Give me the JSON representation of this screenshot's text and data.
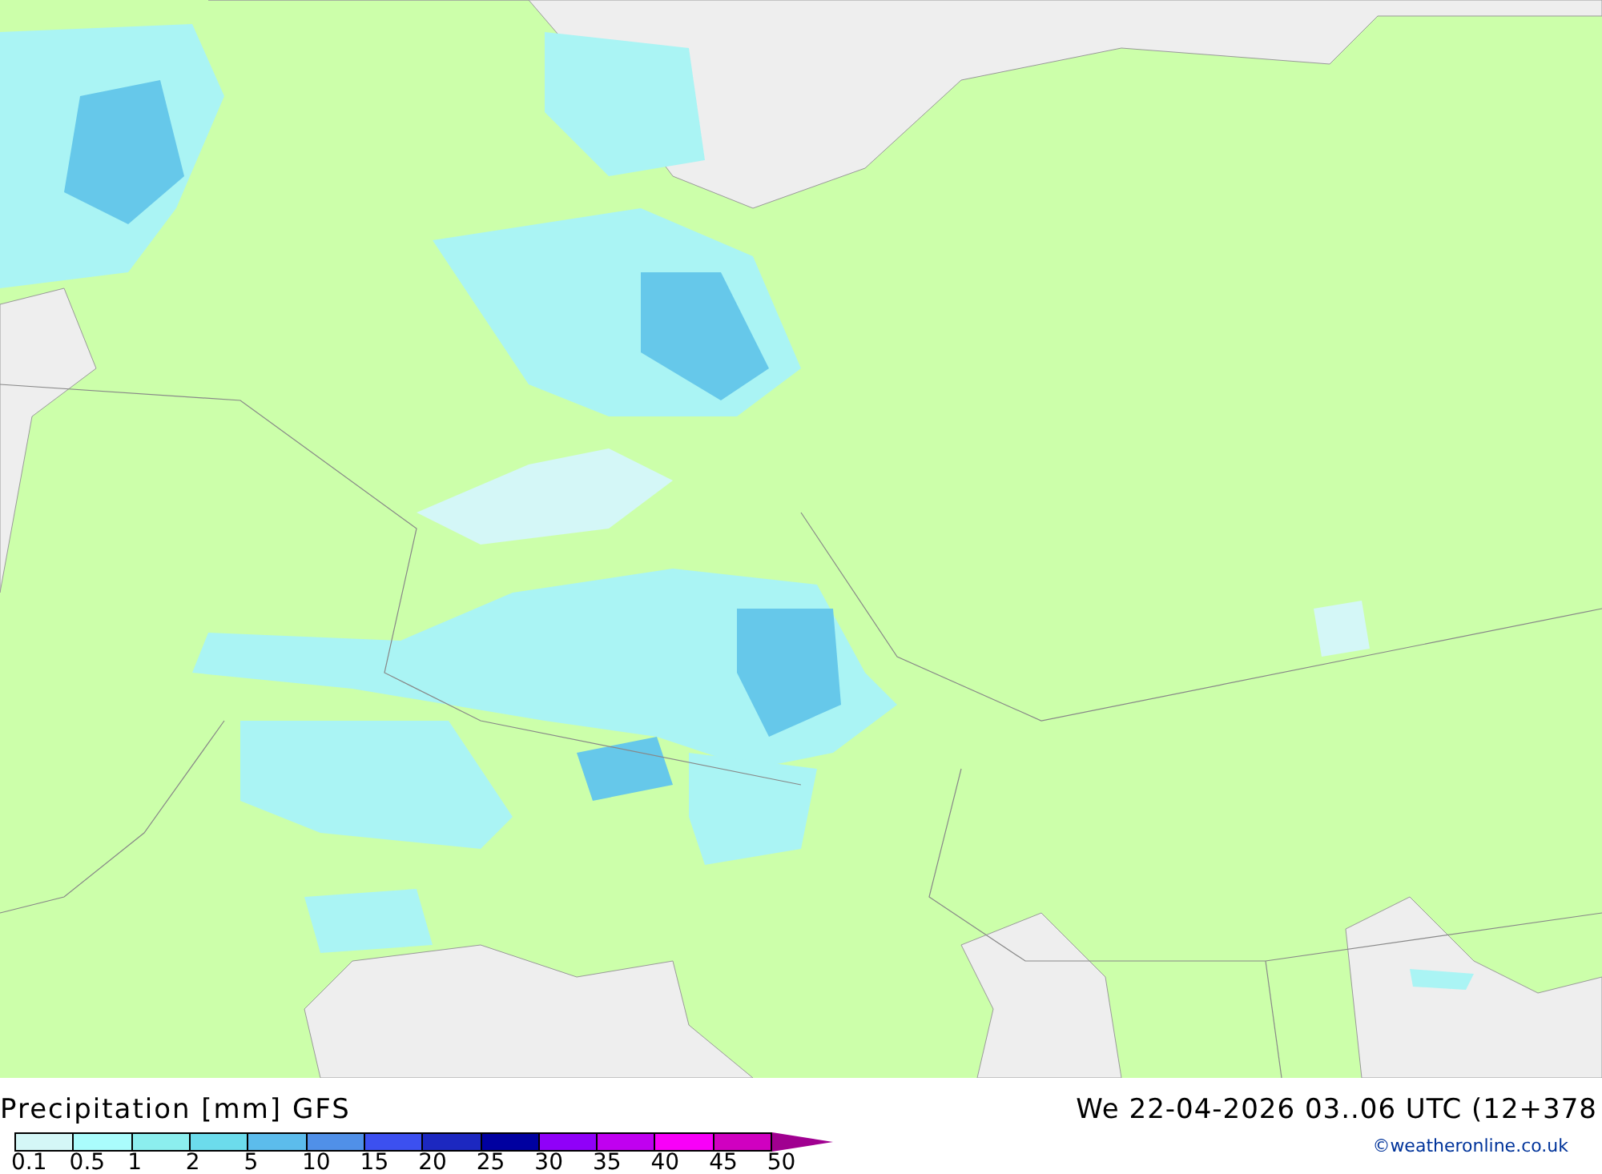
{
  "map": {
    "kind": "precipitation-map"
  },
  "legend": {
    "title": "Precipitation [mm] GFS",
    "valid_time": "We 22-04-2026 03..06 UTC (12+378",
    "scale": [
      {
        "label": "0.1",
        "color": "#d4f7f7"
      },
      {
        "label": "0.5",
        "color": "#aafcfc"
      },
      {
        "label": "1",
        "color": "#8ceeee"
      },
      {
        "label": "2",
        "color": "#6cdcec"
      },
      {
        "label": "5",
        "color": "#5cbcec"
      },
      {
        "label": "10",
        "color": "#5090e8"
      },
      {
        "label": "15",
        "color": "#3c50f0"
      },
      {
        "label": "20",
        "color": "#1c28c0"
      },
      {
        "label": "25",
        "color": "#0000a0"
      },
      {
        "label": "30",
        "color": "#9000f8"
      },
      {
        "label": "35",
        "color": "#c000f0"
      },
      {
        "label": "40",
        "color": "#f800f8"
      },
      {
        "label": "45",
        "color": "#d000c0"
      },
      {
        "label": "50",
        "color": "#a00090"
      }
    ],
    "credit": "©weatheronline.co.uk"
  }
}
